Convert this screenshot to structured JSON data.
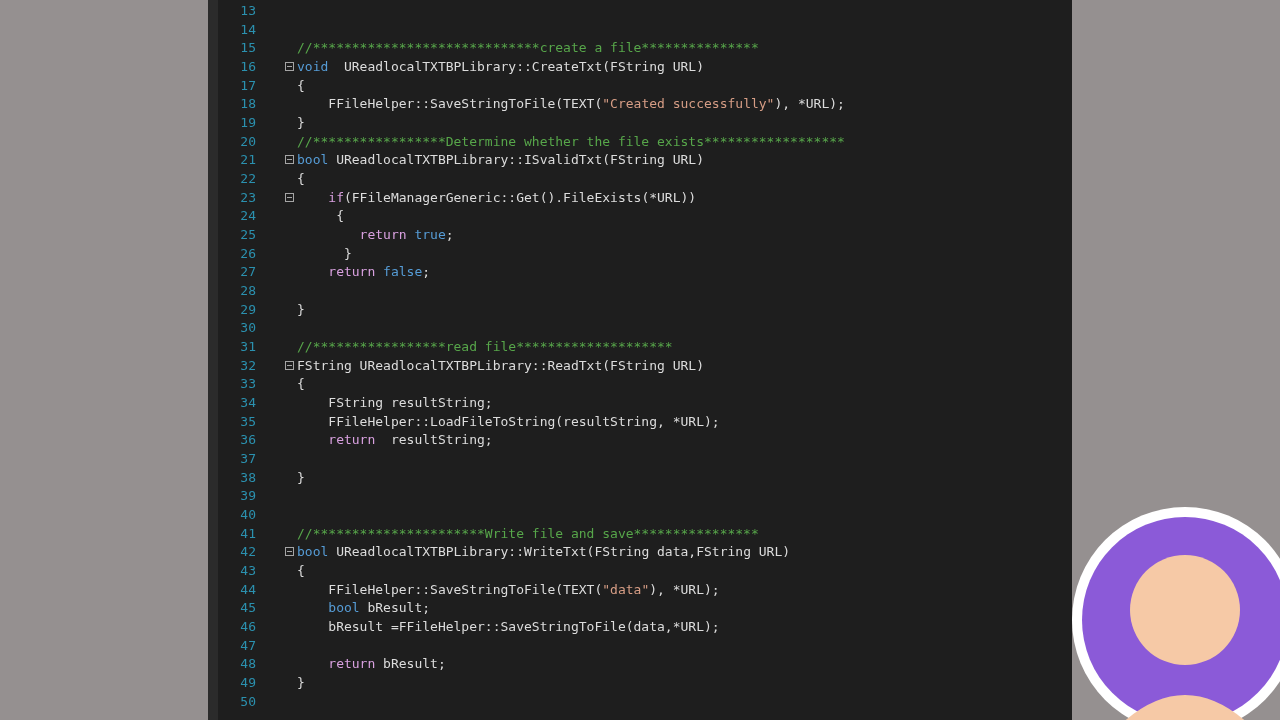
{
  "editor": {
    "lines": [
      {
        "number": "13",
        "collapsible": false
      },
      {
        "number": "14",
        "collapsible": false
      },
      {
        "number": "15",
        "collapsible": false,
        "tokens": [
          {
            "kind": "comment",
            "text": "//*****************************create a file***************"
          }
        ]
      },
      {
        "number": "16",
        "collapsible": true,
        "tokens": [
          {
            "kind": "keyword",
            "text": "void"
          },
          {
            "kind": "plain",
            "text": "  UReadlocalTXTBPLibrary::CreateTxt(FString URL)"
          }
        ]
      },
      {
        "number": "17",
        "collapsible": false,
        "tokens": [
          {
            "kind": "plain",
            "text": "{"
          }
        ]
      },
      {
        "number": "18",
        "collapsible": false,
        "tokens": [
          {
            "kind": "plain",
            "text": "    FFileHelper::SaveStringToFile(TEXT("
          },
          {
            "kind": "string",
            "text": "\"Created successfully\""
          },
          {
            "kind": "plain",
            "text": "), *URL);"
          }
        ]
      },
      {
        "number": "19",
        "collapsible": false,
        "tokens": [
          {
            "kind": "plain",
            "text": "}"
          }
        ]
      },
      {
        "number": "20",
        "collapsible": false,
        "tokens": [
          {
            "kind": "comment",
            "text": "//*****************Determine whether the file exists******************"
          }
        ]
      },
      {
        "number": "21",
        "collapsible": true,
        "tokens": [
          {
            "kind": "keyword",
            "text": "bool"
          },
          {
            "kind": "plain",
            "text": " UReadlocalTXTBPLibrary::ISvalidTxt(FString URL)"
          }
        ]
      },
      {
        "number": "22",
        "collapsible": false,
        "tokens": [
          {
            "kind": "plain",
            "text": "{"
          }
        ]
      },
      {
        "number": "23",
        "collapsible": true,
        "tokens": [
          {
            "kind": "control",
            "text": "    if"
          },
          {
            "kind": "plain",
            "text": "(FFileManagerGeneric::Get().FileExists(*URL))"
          }
        ]
      },
      {
        "number": "24",
        "collapsible": false,
        "tokens": [
          {
            "kind": "plain",
            "text": "     {"
          }
        ]
      },
      {
        "number": "25",
        "collapsible": false,
        "tokens": [
          {
            "kind": "control",
            "text": "        return"
          },
          {
            "kind": "keyword",
            "text": " true"
          },
          {
            "kind": "plain",
            "text": ";"
          }
        ]
      },
      {
        "number": "26",
        "collapsible": false,
        "tokens": [
          {
            "kind": "plain",
            "text": "      }"
          }
        ]
      },
      {
        "number": "27",
        "collapsible": false,
        "tokens": [
          {
            "kind": "control",
            "text": "    return"
          },
          {
            "kind": "keyword",
            "text": " false"
          },
          {
            "kind": "plain",
            "text": ";"
          }
        ]
      },
      {
        "number": "28",
        "collapsible": false
      },
      {
        "number": "29",
        "collapsible": false,
        "tokens": [
          {
            "kind": "plain",
            "text": "}"
          }
        ]
      },
      {
        "number": "30",
        "collapsible": false
      },
      {
        "number": "31",
        "collapsible": false,
        "tokens": [
          {
            "kind": "comment",
            "text": "//*****************read file********************"
          }
        ]
      },
      {
        "number": "32",
        "collapsible": true,
        "tokens": [
          {
            "kind": "plain",
            "text": "FString UReadlocalTXTBPLibrary::ReadTxt(FString URL)"
          }
        ]
      },
      {
        "number": "33",
        "collapsible": false,
        "tokens": [
          {
            "kind": "plain",
            "text": "{"
          }
        ]
      },
      {
        "number": "34",
        "collapsible": false,
        "tokens": [
          {
            "kind": "plain",
            "text": "    FString resultString;"
          }
        ]
      },
      {
        "number": "35",
        "collapsible": false,
        "tokens": [
          {
            "kind": "plain",
            "text": "    FFileHelper::LoadFileToString(resultString, *URL);"
          }
        ]
      },
      {
        "number": "36",
        "collapsible": false,
        "tokens": [
          {
            "kind": "control",
            "text": "    return"
          },
          {
            "kind": "plain",
            "text": "  resultString;"
          }
        ]
      },
      {
        "number": "37",
        "collapsible": false
      },
      {
        "number": "38",
        "collapsible": false,
        "tokens": [
          {
            "kind": "plain",
            "text": "}"
          }
        ]
      },
      {
        "number": "39",
        "collapsible": false
      },
      {
        "number": "40",
        "collapsible": false
      },
      {
        "number": "41",
        "collapsible": false,
        "tokens": [
          {
            "kind": "comment",
            "text": "//**********************Write file and save****************"
          }
        ]
      },
      {
        "number": "42",
        "collapsible": true,
        "tokens": [
          {
            "kind": "keyword",
            "text": "bool"
          },
          {
            "kind": "plain",
            "text": " UReadlocalTXTBPLibrary::WriteTxt(FString data,FString URL)"
          }
        ]
      },
      {
        "number": "43",
        "collapsible": false,
        "tokens": [
          {
            "kind": "plain",
            "text": "{"
          }
        ]
      },
      {
        "number": "44",
        "collapsible": false,
        "tokens": [
          {
            "kind": "plain",
            "text": "    FFileHelper::SaveStringToFile(TEXT("
          },
          {
            "kind": "string",
            "text": "\"data\""
          },
          {
            "kind": "plain",
            "text": "), *URL);"
          }
        ]
      },
      {
        "number": "45",
        "collapsible": false,
        "tokens": [
          {
            "kind": "keyword",
            "text": "    bool"
          },
          {
            "kind": "plain",
            "text": " bResult;"
          }
        ]
      },
      {
        "number": "46",
        "collapsible": false,
        "tokens": [
          {
            "kind": "plain",
            "text": "    bResult =FFileHelper::SaveStringToFile(data,*URL);"
          }
        ]
      },
      {
        "number": "47",
        "collapsible": false
      },
      {
        "number": "48",
        "collapsible": false,
        "tokens": [
          {
            "kind": "control",
            "text": "    return"
          },
          {
            "kind": "plain",
            "text": " bResult;"
          }
        ]
      },
      {
        "number": "49",
        "collapsible": false,
        "tokens": [
          {
            "kind": "plain",
            "text": "}"
          }
        ]
      },
      {
        "number": "50",
        "collapsible": false
      }
    ]
  }
}
